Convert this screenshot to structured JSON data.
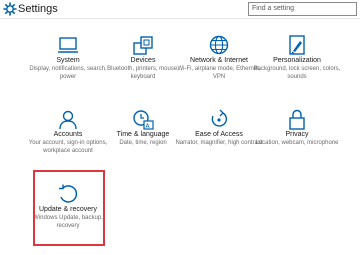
{
  "window": {
    "title": "Settings"
  },
  "search": {
    "placeholder": "Find a setting"
  },
  "tiles": [
    {
      "title": "System",
      "desc": "Display, notifications, search, power",
      "icon": "laptop-icon"
    },
    {
      "title": "Devices",
      "desc": "Bluetooth, printers, mouse, keyboard",
      "icon": "devices-icon"
    },
    {
      "title": "Network & Internet",
      "desc": "Wi-Fi, airplane mode, Ethernet, VPN",
      "icon": "globe-icon"
    },
    {
      "title": "Personalization",
      "desc": "Background, lock screen, colors, sounds",
      "icon": "paint-icon"
    },
    {
      "title": "Accounts",
      "desc": "Your account, sign-in options, workplace account",
      "icon": "person-icon"
    },
    {
      "title": "Time & language",
      "desc": "Date, time, region",
      "icon": "clock-language-icon"
    },
    {
      "title": "Ease of Access",
      "desc": "Narrator, magnifier, high contrast",
      "icon": "ease-of-access-icon"
    },
    {
      "title": "Privacy",
      "desc": "Location, webcam, microphone",
      "icon": "lock-icon"
    },
    {
      "title": "Update & recovery",
      "desc": "Windows Update, backup, recovery",
      "icon": "refresh-icon"
    }
  ],
  "colors": {
    "accent": "#0063b1",
    "highlight": "#d9393e"
  }
}
